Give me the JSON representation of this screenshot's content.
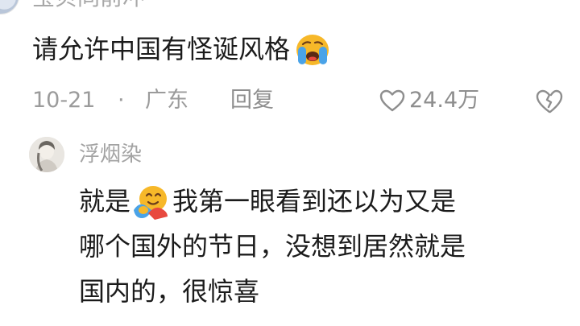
{
  "top_comment": {
    "author": "宝贝同前冲",
    "text": "请允许中国有怪诞风格",
    "emoji": "loudly-crying-face-emoji",
    "meta": {
      "date": "10-21",
      "separator": "·",
      "location": "广东",
      "reply_label": "回复",
      "like_count": "24.4万"
    }
  },
  "reply": {
    "author": "浮烟染",
    "text_line1_before": "就是",
    "emoji": "hugging-face-emoji",
    "text_line1_after": "我第一眼看到还以为又是",
    "text_line2": "哪个国外的节日，没想到居然就是",
    "text_line3": "国内的，很惊喜"
  },
  "colors": {
    "text_primary": "#1b1b1b",
    "text_secondary": "#9b9b9b",
    "emoji_yellow": "#f7b829",
    "emoji_blue": "#4aa3e8",
    "emoji_red": "#e8493f"
  }
}
